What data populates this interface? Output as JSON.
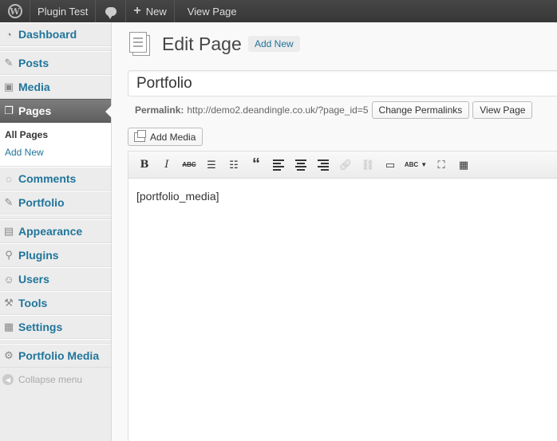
{
  "adminbar": {
    "site_name": "Plugin Test",
    "new_label": "New",
    "view_page_label": "View Page"
  },
  "sidebar": {
    "items": [
      {
        "label": "Dashboard",
        "icon": "dashboard-icon"
      },
      {
        "label": "Posts",
        "icon": "pin-icon"
      },
      {
        "label": "Media",
        "icon": "media-icon"
      },
      {
        "label": "Pages",
        "icon": "pages-icon"
      },
      {
        "label": "Comments",
        "icon": "comment-icon"
      },
      {
        "label": "Portfolio",
        "icon": "pin-icon"
      },
      {
        "label": "Appearance",
        "icon": "appearance-icon"
      },
      {
        "label": "Plugins",
        "icon": "plugin-icon"
      },
      {
        "label": "Users",
        "icon": "users-icon"
      },
      {
        "label": "Tools",
        "icon": "tools-icon"
      },
      {
        "label": "Settings",
        "icon": "settings-icon"
      },
      {
        "label": "Portfolio Media",
        "icon": "gear-icon"
      }
    ],
    "submenu": {
      "all_pages": "All Pages",
      "add_new": "Add New"
    },
    "collapse_label": "Collapse menu"
  },
  "main": {
    "title": "Edit Page",
    "add_new_label": "Add New",
    "post_title": "Portfolio",
    "permalink_label": "Permalink:",
    "permalink_url": "http://demo2.deandingle.co.uk/?page_id=5",
    "change_permalinks_label": "Change Permalinks",
    "view_page_label": "View Page",
    "add_media_label": "Add Media",
    "editor_content": "[portfolio_media]"
  },
  "toolbar": {
    "bold": "B",
    "italic": "I",
    "strikethrough": "ABC",
    "blockquote": "“",
    "spellcheck": "ABC"
  }
}
